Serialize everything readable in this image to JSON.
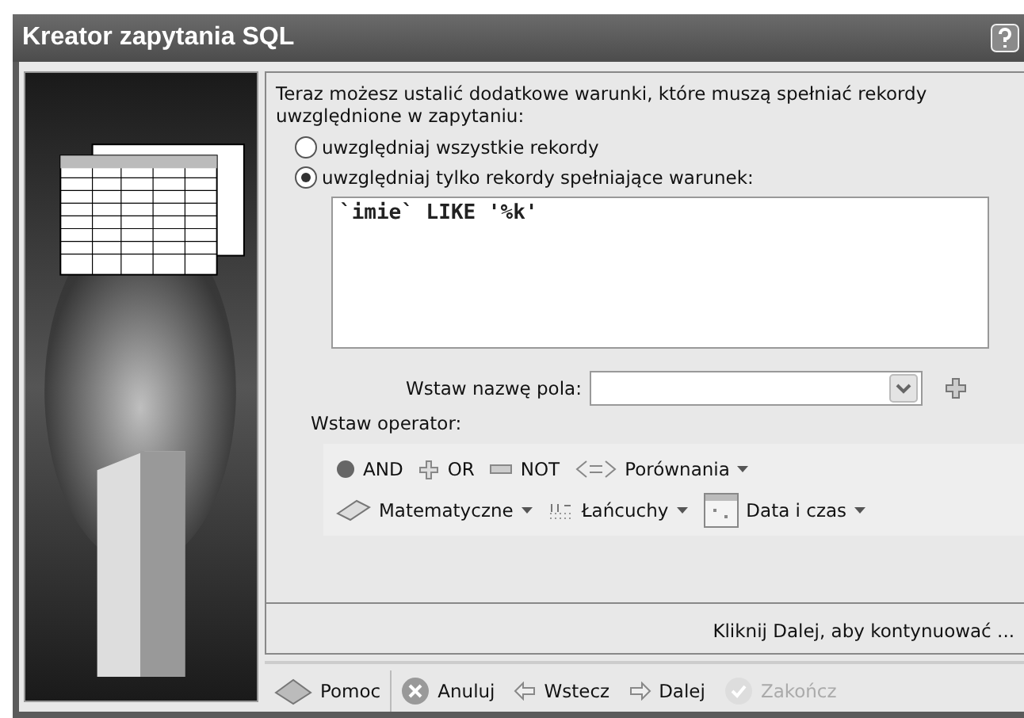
{
  "window": {
    "title": "Kreator zapytania SQL"
  },
  "intro": "Teraz możesz ustalić dodatkowe warunki, które muszą spełniać rekordy uwzględnione w zapytaniu:",
  "radios": [
    {
      "label": "uwzględniaj wszystkie rekordy",
      "selected": false
    },
    {
      "label": "uwzględniaj tylko rekordy spełniające warunek:",
      "selected": true
    }
  ],
  "condition": {
    "value": "`imie` LIKE '%k'"
  },
  "field_name": {
    "label": "Wstaw nazwę pola:"
  },
  "operator_label": "Wstaw operator:",
  "operator_rows": [
    [
      {
        "kind": "and",
        "label": "AND",
        "dropdown": false
      },
      {
        "kind": "or",
        "label": "OR",
        "dropdown": false
      },
      {
        "kind": "not",
        "label": "NOT",
        "dropdown": false
      },
      {
        "kind": "compare",
        "label": "Porównania",
        "dropdown": true
      }
    ],
    [
      {
        "kind": "math",
        "label": "Matematyczne",
        "dropdown": true
      },
      {
        "kind": "string",
        "label": "Łańcuchy",
        "dropdown": true
      },
      {
        "kind": "date",
        "label": "Data i czas",
        "dropdown": true
      }
    ]
  ],
  "hint": "Kliknij Dalej, aby kontynuować ...",
  "buttons": [
    {
      "kind": "help",
      "label": "Pomoc",
      "disabled": false
    },
    {
      "kind": "cancel",
      "label": "Anuluj",
      "disabled": false
    },
    {
      "kind": "back",
      "label": "Wstecz",
      "disabled": false
    },
    {
      "kind": "next",
      "label": "Dalej",
      "disabled": false
    },
    {
      "kind": "finish",
      "label": "Zakończ",
      "disabled": true
    }
  ]
}
